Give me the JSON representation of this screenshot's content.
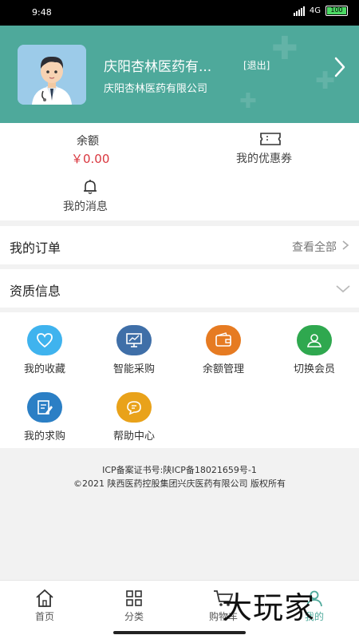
{
  "status_bar": {
    "time": "9:48",
    "network": "4G",
    "battery": "100"
  },
  "header": {
    "shop_name": "庆阳杏林医药有...",
    "logout_label": "[退出]",
    "company": "庆阳杏林医药有限公司"
  },
  "stats": {
    "balance_label": "余额",
    "balance_value": "￥0.00",
    "coupon_label": "我的优惠券",
    "messages_label": "我的消息"
  },
  "orders": {
    "title": "我的订单",
    "view_all": "查看全部"
  },
  "qualification": {
    "title": "资质信息"
  },
  "grid_items": [
    {
      "label": "我的收藏",
      "icon": "heart-icon",
      "color": "#3fb3ee"
    },
    {
      "label": "智能采购",
      "icon": "chart-board-icon",
      "color": "#3f6fa8"
    },
    {
      "label": "余额管理",
      "icon": "wallet-icon",
      "color": "#e67b22"
    },
    {
      "label": "切换会员",
      "icon": "user-switch-icon",
      "color": "#2fa84f"
    },
    {
      "label": "我的求购",
      "icon": "edit-note-icon",
      "color": "#2b7fc5"
    },
    {
      "label": "帮助中心",
      "icon": "chat-help-icon",
      "color": "#e9a21a"
    }
  ],
  "footer": {
    "icp": "ICP备案证书号:陕ICP备18021659号-1",
    "copyright": "©2021 陕西医药控股集团兴庆医药有限公司 版权所有"
  },
  "tabs": [
    {
      "label": "首页",
      "icon": "home-icon"
    },
    {
      "label": "分类",
      "icon": "grid-icon"
    },
    {
      "label": "购物车",
      "icon": "cart-icon"
    },
    {
      "label": "我的",
      "icon": "profile-icon"
    }
  ],
  "watermark": "大玩家",
  "colors": {
    "header_bg": "#4ea99b",
    "balance": "#d9363e"
  }
}
